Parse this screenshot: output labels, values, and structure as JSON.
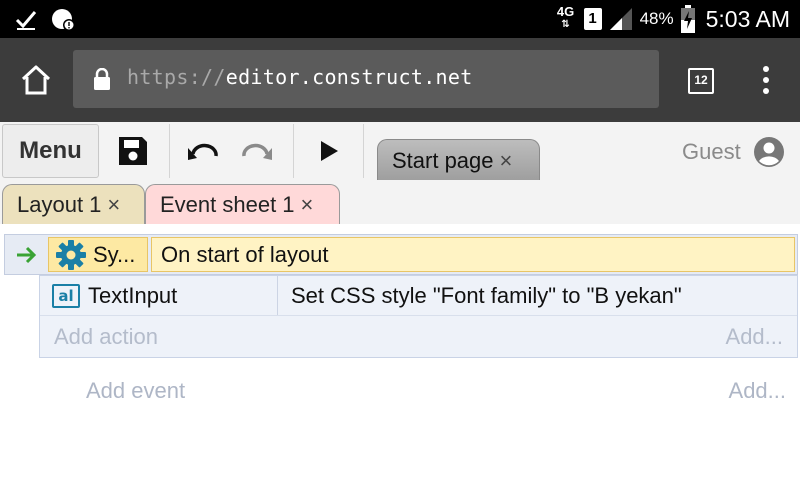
{
  "status_bar": {
    "network": "4G",
    "sim": "1",
    "battery": "48%",
    "time": "5:03 AM",
    "icons": [
      "check-icon",
      "data-saver-icon",
      "signal-icon",
      "battery-charging-icon"
    ]
  },
  "browser": {
    "url_scheme": "https://",
    "url_host": "editor.construct.net",
    "tab_count": "12"
  },
  "toolbar": {
    "menu_label": "Menu",
    "tab_label": "Start page",
    "close_glyph": "×",
    "user_label": "Guest"
  },
  "doc_tabs": [
    {
      "label": "Layout 1",
      "close": "×",
      "color": "#ece1bd"
    },
    {
      "label": "Event sheet 1",
      "close": "×",
      "color": "#ffd9d9"
    }
  ],
  "event_sheet": {
    "event": {
      "object": "Sy...",
      "condition": "On start of layout"
    },
    "actions": [
      {
        "object": "TextInput",
        "icon_text": "al",
        "text": "Set CSS style \"Font family\" to \"B yekan\""
      }
    ],
    "add_action": "Add action",
    "add_action_short": "Add...",
    "add_event": "Add event",
    "add_event_short": "Add..."
  },
  "colors": {
    "accent": "#1a7fa6",
    "event_arrow": "#3aa335",
    "condition_bg": "#fff3c4"
  }
}
